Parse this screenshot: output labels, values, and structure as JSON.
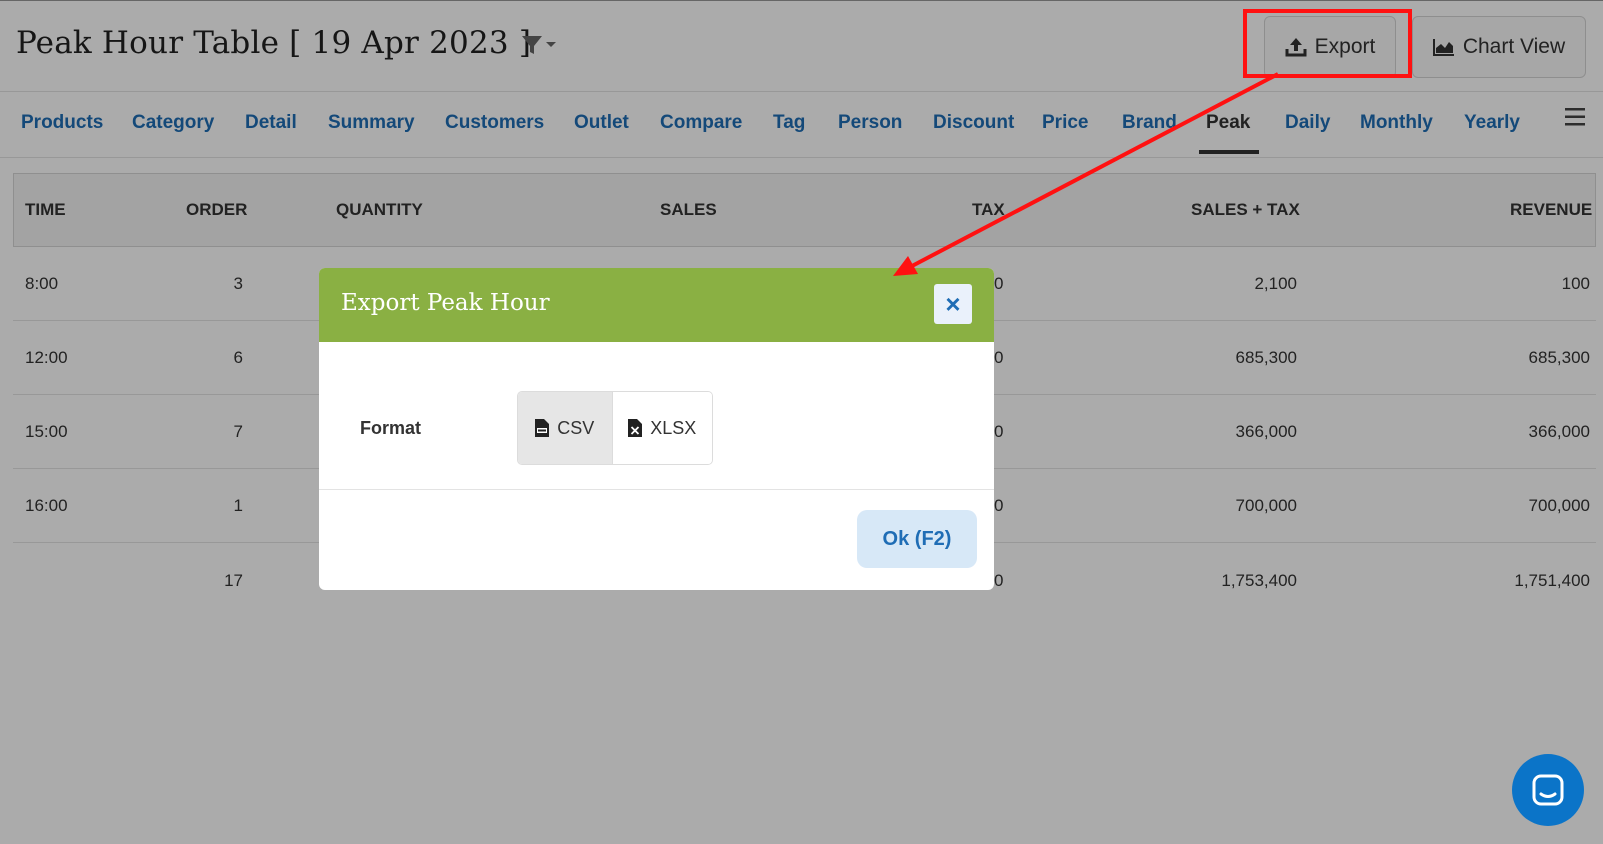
{
  "page": {
    "title": "Peak Hour Table [ 19 Apr 2023 ]",
    "export_label": "Export",
    "chart_view_label": "Chart View"
  },
  "tabs": [
    {
      "label": "Products"
    },
    {
      "label": "Category"
    },
    {
      "label": "Detail"
    },
    {
      "label": "Summary"
    },
    {
      "label": "Customers"
    },
    {
      "label": "Outlet"
    },
    {
      "label": "Compare"
    },
    {
      "label": "Tag"
    },
    {
      "label": "Person"
    },
    {
      "label": "Discount"
    },
    {
      "label": "Price"
    },
    {
      "label": "Brand"
    },
    {
      "label": "Peak",
      "active": true
    },
    {
      "label": "Daily"
    },
    {
      "label": "Monthly"
    },
    {
      "label": "Yearly"
    }
  ],
  "table": {
    "headers": [
      "TIME",
      "ORDER",
      "QUANTITY",
      "SALES",
      "TAX",
      "SALES + TAX",
      "REVENUE"
    ],
    "rows": [
      {
        "time": "8:00",
        "order": "3",
        "tax_tail": "0",
        "sales_tax": "2,100",
        "revenue": "100"
      },
      {
        "time": "12:00",
        "order": "6",
        "tax_tail": "0",
        "sales_tax": "685,300",
        "revenue": "685,300"
      },
      {
        "time": "15:00",
        "order": "7",
        "tax_tail": "0",
        "sales_tax": "366,000",
        "revenue": "366,000"
      },
      {
        "time": "16:00",
        "order": "1",
        "tax_tail": "0",
        "sales_tax": "700,000",
        "revenue": "700,000"
      }
    ],
    "total": {
      "order": "17",
      "tax_tail": "0",
      "sales_tax": "1,753,400",
      "revenue": "1,751,400"
    }
  },
  "modal": {
    "title": "Export Peak Hour",
    "close": "×",
    "format_label": "Format",
    "options": [
      {
        "label": "CSV",
        "selected": true
      },
      {
        "label": "XLSX",
        "selected": false
      }
    ],
    "ok_label": "Ok (F2)"
  },
  "colors": {
    "tab_link": "#1f6db5",
    "modal_header": "#8ab043",
    "annotation": "#ff1111",
    "chat": "#0b74c8"
  }
}
